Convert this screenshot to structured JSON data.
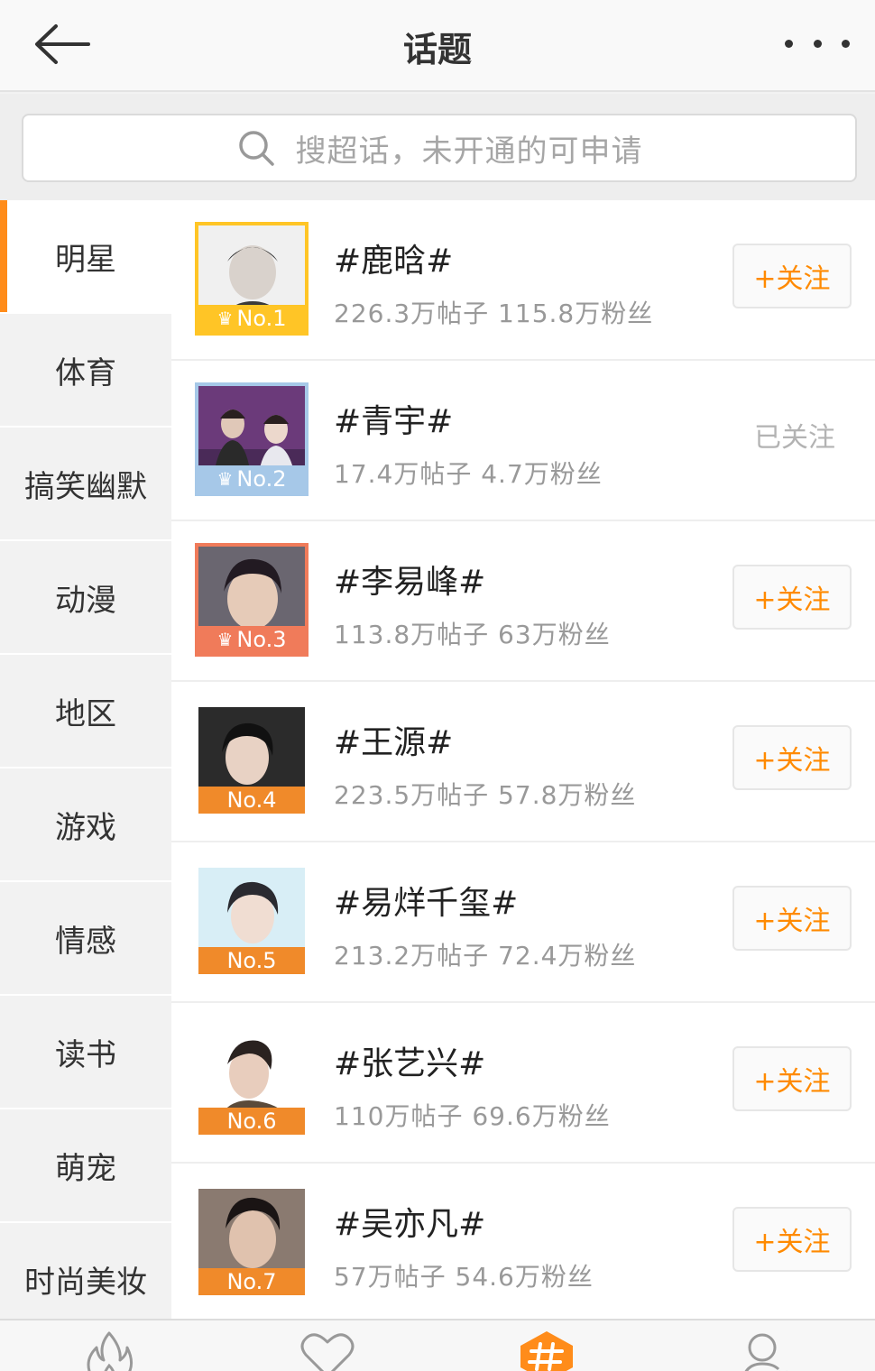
{
  "header": {
    "title": "话题",
    "back_icon": "arrow-left-icon",
    "more_icon": "more-dots-icon"
  },
  "search": {
    "placeholder": "搜超话，未开通的可申请",
    "icon": "search-icon"
  },
  "sidebar": {
    "items": [
      {
        "label": "明星",
        "active": true
      },
      {
        "label": "体育"
      },
      {
        "label": "搞笑幽默"
      },
      {
        "label": "动漫"
      },
      {
        "label": "地区"
      },
      {
        "label": "游戏"
      },
      {
        "label": "情感"
      },
      {
        "label": "读书"
      },
      {
        "label": "萌宠"
      },
      {
        "label": "时尚美妆"
      }
    ]
  },
  "topics": [
    {
      "name": "#鹿晗#",
      "stats": "226.3万帖子  115.8万粉丝",
      "rank": "No.1",
      "follow_label": "+关注",
      "followed": false
    },
    {
      "name": "#青宇#",
      "stats": "17.4万帖子  4.7万粉丝",
      "rank": "No.2",
      "follow_label": "已关注",
      "followed": true
    },
    {
      "name": "#李易峰#",
      "stats": "113.8万帖子  63万粉丝",
      "rank": "No.3",
      "follow_label": "+关注",
      "followed": false
    },
    {
      "name": "#王源#",
      "stats": "223.5万帖子  57.8万粉丝",
      "rank": "No.4",
      "follow_label": "+关注",
      "followed": false
    },
    {
      "name": "#易烊千玺#",
      "stats": "213.2万帖子  72.4万粉丝",
      "rank": "No.5",
      "follow_label": "+关注",
      "followed": false
    },
    {
      "name": "#张艺兴#",
      "stats": "110万帖子  69.6万粉丝",
      "rank": "No.6",
      "follow_label": "+关注",
      "followed": false
    },
    {
      "name": "#吴亦凡#",
      "stats": "57万帖子  54.6万粉丝",
      "rank": "No.7",
      "follow_label": "+关注",
      "followed": false
    }
  ],
  "tabbar": {
    "tabs": [
      {
        "icon": "flame-icon"
      },
      {
        "icon": "heart-icon"
      },
      {
        "icon": "hashtag-icon",
        "active": true
      },
      {
        "icon": "profile-hashtag-icon"
      }
    ]
  },
  "colors": {
    "accent": "#ff8c1a",
    "rank1": "#ffc526",
    "rank2": "#a6c8e8",
    "rank3": "#f07b5a",
    "rank_default": "#f08a2a"
  }
}
